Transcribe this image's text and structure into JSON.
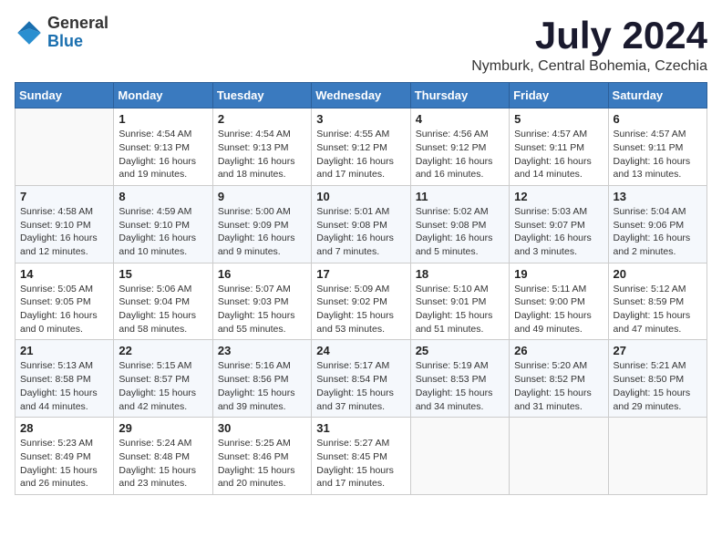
{
  "header": {
    "logo_general": "General",
    "logo_blue": "Blue",
    "month_title": "July 2024",
    "location": "Nymburk, Central Bohemia, Czechia"
  },
  "days_of_week": [
    "Sunday",
    "Monday",
    "Tuesday",
    "Wednesday",
    "Thursday",
    "Friday",
    "Saturday"
  ],
  "weeks": [
    [
      {
        "day": "",
        "empty": true
      },
      {
        "day": "1",
        "sunrise": "4:54 AM",
        "sunset": "9:13 PM",
        "daylight": "16 hours and 19 minutes."
      },
      {
        "day": "2",
        "sunrise": "4:54 AM",
        "sunset": "9:13 PM",
        "daylight": "16 hours and 18 minutes."
      },
      {
        "day": "3",
        "sunrise": "4:55 AM",
        "sunset": "9:12 PM",
        "daylight": "16 hours and 17 minutes."
      },
      {
        "day": "4",
        "sunrise": "4:56 AM",
        "sunset": "9:12 PM",
        "daylight": "16 hours and 16 minutes."
      },
      {
        "day": "5",
        "sunrise": "4:57 AM",
        "sunset": "9:11 PM",
        "daylight": "16 hours and 14 minutes."
      },
      {
        "day": "6",
        "sunrise": "4:57 AM",
        "sunset": "9:11 PM",
        "daylight": "16 hours and 13 minutes."
      }
    ],
    [
      {
        "day": "7",
        "sunrise": "4:58 AM",
        "sunset": "9:10 PM",
        "daylight": "16 hours and 12 minutes."
      },
      {
        "day": "8",
        "sunrise": "4:59 AM",
        "sunset": "9:10 PM",
        "daylight": "16 hours and 10 minutes."
      },
      {
        "day": "9",
        "sunrise": "5:00 AM",
        "sunset": "9:09 PM",
        "daylight": "16 hours and 9 minutes."
      },
      {
        "day": "10",
        "sunrise": "5:01 AM",
        "sunset": "9:08 PM",
        "daylight": "16 hours and 7 minutes."
      },
      {
        "day": "11",
        "sunrise": "5:02 AM",
        "sunset": "9:08 PM",
        "daylight": "16 hours and 5 minutes."
      },
      {
        "day": "12",
        "sunrise": "5:03 AM",
        "sunset": "9:07 PM",
        "daylight": "16 hours and 3 minutes."
      },
      {
        "day": "13",
        "sunrise": "5:04 AM",
        "sunset": "9:06 PM",
        "daylight": "16 hours and 2 minutes."
      }
    ],
    [
      {
        "day": "14",
        "sunrise": "5:05 AM",
        "sunset": "9:05 PM",
        "daylight": "16 hours and 0 minutes."
      },
      {
        "day": "15",
        "sunrise": "5:06 AM",
        "sunset": "9:04 PM",
        "daylight": "15 hours and 58 minutes."
      },
      {
        "day": "16",
        "sunrise": "5:07 AM",
        "sunset": "9:03 PM",
        "daylight": "15 hours and 55 minutes."
      },
      {
        "day": "17",
        "sunrise": "5:09 AM",
        "sunset": "9:02 PM",
        "daylight": "15 hours and 53 minutes."
      },
      {
        "day": "18",
        "sunrise": "5:10 AM",
        "sunset": "9:01 PM",
        "daylight": "15 hours and 51 minutes."
      },
      {
        "day": "19",
        "sunrise": "5:11 AM",
        "sunset": "9:00 PM",
        "daylight": "15 hours and 49 minutes."
      },
      {
        "day": "20",
        "sunrise": "5:12 AM",
        "sunset": "8:59 PM",
        "daylight": "15 hours and 47 minutes."
      }
    ],
    [
      {
        "day": "21",
        "sunrise": "5:13 AM",
        "sunset": "8:58 PM",
        "daylight": "15 hours and 44 minutes."
      },
      {
        "day": "22",
        "sunrise": "5:15 AM",
        "sunset": "8:57 PM",
        "daylight": "15 hours and 42 minutes."
      },
      {
        "day": "23",
        "sunrise": "5:16 AM",
        "sunset": "8:56 PM",
        "daylight": "15 hours and 39 minutes."
      },
      {
        "day": "24",
        "sunrise": "5:17 AM",
        "sunset": "8:54 PM",
        "daylight": "15 hours and 37 minutes."
      },
      {
        "day": "25",
        "sunrise": "5:19 AM",
        "sunset": "8:53 PM",
        "daylight": "15 hours and 34 minutes."
      },
      {
        "day": "26",
        "sunrise": "5:20 AM",
        "sunset": "8:52 PM",
        "daylight": "15 hours and 31 minutes."
      },
      {
        "day": "27",
        "sunrise": "5:21 AM",
        "sunset": "8:50 PM",
        "daylight": "15 hours and 29 minutes."
      }
    ],
    [
      {
        "day": "28",
        "sunrise": "5:23 AM",
        "sunset": "8:49 PM",
        "daylight": "15 hours and 26 minutes."
      },
      {
        "day": "29",
        "sunrise": "5:24 AM",
        "sunset": "8:48 PM",
        "daylight": "15 hours and 23 minutes."
      },
      {
        "day": "30",
        "sunrise": "5:25 AM",
        "sunset": "8:46 PM",
        "daylight": "15 hours and 20 minutes."
      },
      {
        "day": "31",
        "sunrise": "5:27 AM",
        "sunset": "8:45 PM",
        "daylight": "15 hours and 17 minutes."
      },
      {
        "day": "",
        "empty": true
      },
      {
        "day": "",
        "empty": true
      },
      {
        "day": "",
        "empty": true
      }
    ]
  ]
}
